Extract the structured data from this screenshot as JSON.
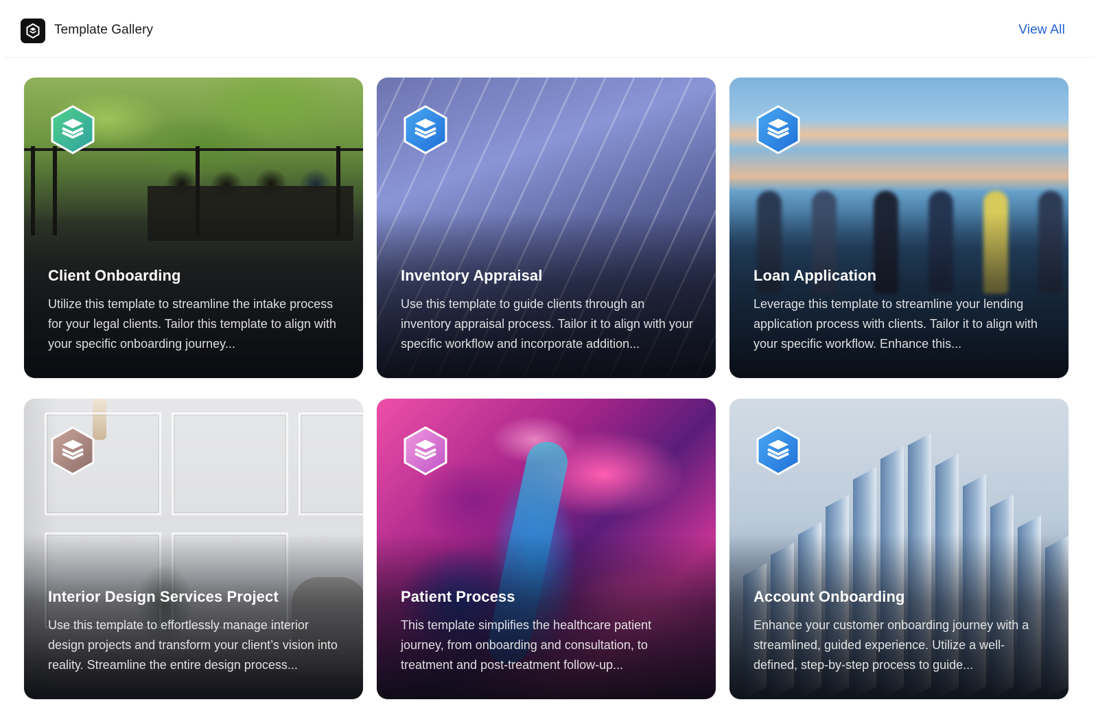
{
  "header": {
    "app_title": "Template Gallery",
    "logo_icon": "hexagon-logo-icon",
    "view_all_label": "View All"
  },
  "colors": {
    "accent_link": "#1f5fd6",
    "card_title": "#ffffff"
  },
  "cards": [
    {
      "title": "Client Onboarding",
      "description": "Utilize this template to streamline the intake process for your legal clients. Tailor this template to align with your specific onboarding journey...",
      "icon": "layers-hexagon-icon",
      "badge_color": "green"
    },
    {
      "title": "Inventory Appraisal",
      "description": "Use this template to guide clients through an inventory appraisal process. Tailor it to align with your specific workflow and incorporate addition...",
      "icon": "layers-hexagon-icon",
      "badge_color": "blue"
    },
    {
      "title": "Loan Application",
      "description": "Leverage this template to streamline your lending application process with clients. Tailor it to align with your specific workflow. Enhance this...",
      "icon": "layers-hexagon-icon",
      "badge_color": "blue"
    },
    {
      "title": "Interior Design Services Project",
      "description": "Use this template to effortlessly manage interior design projects and transform your client’s vision into reality. Streamline the entire design process...",
      "icon": "layers-hexagon-icon",
      "badge_color": "mauve"
    },
    {
      "title": "Patient Process",
      "description": "This template simplifies the healthcare patient journey, from onboarding and consultation, to treatment and post-treatment follow-up...",
      "icon": "layers-hexagon-icon",
      "badge_color": "pink"
    },
    {
      "title": "Account Onboarding",
      "description": "Enhance your customer onboarding journey with a streamlined, guided experience. Utilize a well-defined, step-by-step process to guide...",
      "icon": "layers-hexagon-icon",
      "badge_color": "blue"
    }
  ]
}
